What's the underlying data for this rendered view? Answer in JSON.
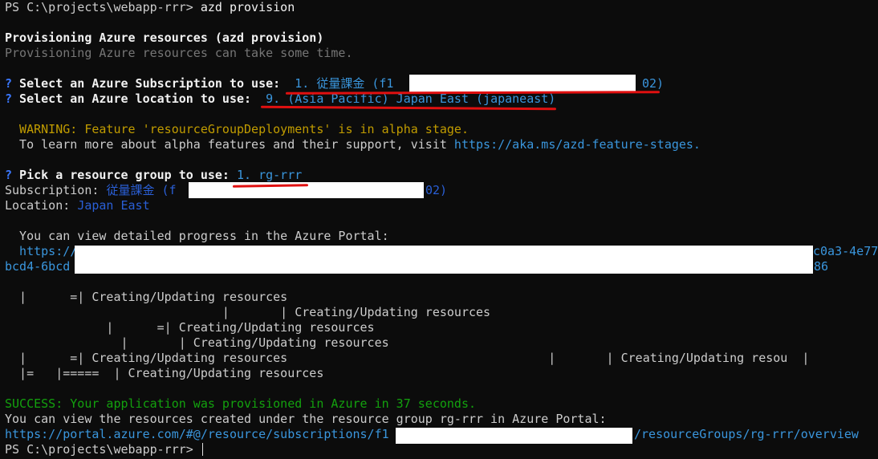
{
  "terminal": {
    "prompt": "PS C:\\projects\\webapp-rrr> ",
    "command": "azd provision",
    "heading": "Provisioning Azure resources (azd provision)",
    "subheading": "Provisioning Azure resources can take some time.",
    "q_mark": "?",
    "subscription_question": " Select an Azure Subscription to use:  ",
    "subscription_value_start": "1. 従量課金 (f1",
    "subscription_value_end": "02)",
    "location_question": " Select an Azure location to use:  ",
    "location_value": "9. (Asia Pacific) Japan East (japaneast)",
    "warning_prefix": "  WARNING: Feature 'resourceGroupDeployments' is in alpha stage.",
    "learn_more_text": "  To learn more about alpha features and their support, visit ",
    "learn_more_link": "https://aka.ms/azd-feature-stages.",
    "rg_question": " Pick a resource group to use: ",
    "rg_value": "1. rg-rrr",
    "subscription_label": "Subscription: ",
    "subscription_detail_start": "従量課金 (f",
    "subscription_detail_end": "02)",
    "location_label": "Location: ",
    "location_detail": "Japan East",
    "portal_progress_text": "  You can view detailed progress in the Azure Portal:",
    "portal_link_start": "  https://",
    "portal_link_end_1": "c0a3-4e77",
    "portal_link_line2_start": "bcd4-6bcd",
    "portal_link_line2_end": "86",
    "progress_lines": [
      "  |      =| Creating/Updating resources",
      "                              |       | Creating/Updating resources",
      "              |      =| Creating/Updating resources",
      "                |       | Creating/Updating resources",
      "  |      =| Creating/Updating resources                                    |       | Creating/Updating resou  |",
      "  |=   |=====  | Creating/Updating resources"
    ],
    "success_text": "SUCCESS: Your application was provisioned in Azure in 37 seconds.",
    "view_resources_text": "You can view the resources created under the resource group rg-rrr in Azure Portal:",
    "portal_url_start": "https://portal.azure.com/#@/resource/subscriptions/f1",
    "portal_url_end": "/resourceGroups/rg-rrr/overview"
  },
  "colors": {
    "background": "#0c0c0c",
    "text": "#cccccc",
    "blue": "#3b78ff",
    "yellow": "#c19c00",
    "cyan": "#3a96dd",
    "green": "#13a10e",
    "gray": "#767676",
    "redact": "#ffffff",
    "annotation": "#e01010"
  }
}
